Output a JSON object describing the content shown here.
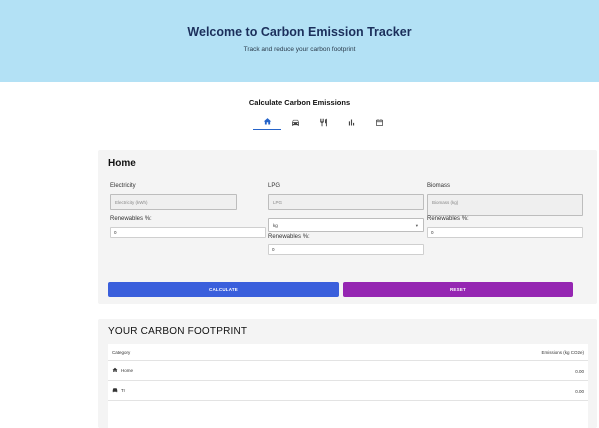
{
  "header": {
    "title": "Welcome to Carbon Emission Tracker",
    "subtitle": "Track and reduce your carbon footprint"
  },
  "calculator": {
    "title": "Calculate Carbon Emissions",
    "tabs": [
      {
        "icon": "home-icon",
        "active": true
      },
      {
        "icon": "car-icon",
        "active": false
      },
      {
        "icon": "utensils-icon",
        "active": false
      },
      {
        "icon": "bar-chart-icon",
        "active": false
      },
      {
        "icon": "calendar-icon",
        "active": false
      }
    ]
  },
  "home_card": {
    "title": "Home",
    "electricity": {
      "label": "Electricity",
      "placeholder": "Electricity (kWh)",
      "renewables_label": "Renewables %:",
      "renewables_value": "0"
    },
    "lpg": {
      "label": "LPG",
      "placeholder": "LPG",
      "unit_value": "kg",
      "renewables_label": "Renewables %:",
      "renewables_value": "0"
    },
    "biomass": {
      "label": "Biomass",
      "placeholder": "Biomass (kg)",
      "renewables_label": "Renewables %:",
      "renewables_value": "0"
    },
    "calculate_label": "CALCULATE",
    "reset_label": "RESET"
  },
  "footprint": {
    "title": "YOUR CARBON FOOTPRINT",
    "col_category": "Category",
    "col_emissions": "Emissions (kg CO2e)",
    "rows": [
      {
        "icon": "home-icon",
        "category": "Home",
        "value": "0.00"
      },
      {
        "icon": "car-icon",
        "category": "Tr",
        "value": "0.00"
      }
    ]
  },
  "colors": {
    "header_bg": "#b3e1f5",
    "accent": "#2563c9",
    "calculate": "#3a5fdc",
    "reset": "#9526b2"
  }
}
